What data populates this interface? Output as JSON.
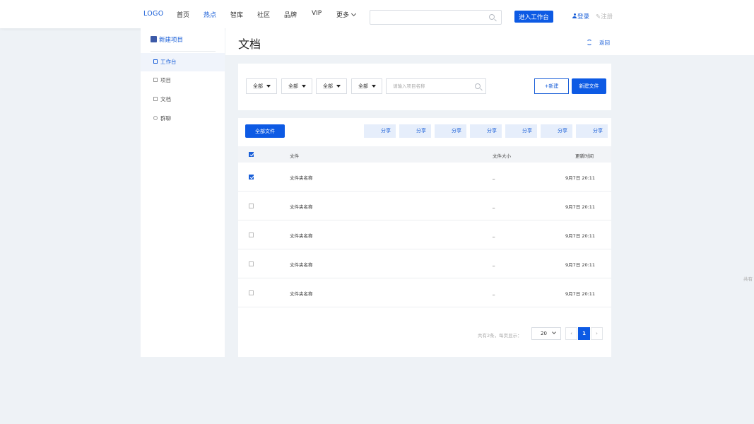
{
  "header": {
    "logo": "LOGO",
    "nav": [
      "首页",
      "热点",
      "智库",
      "社区",
      "品牌",
      "VIP",
      "更多"
    ],
    "active_nav": "热点",
    "enter_button": "进入工作台",
    "login": "登录",
    "register": "注册"
  },
  "sidebar": {
    "title": "新建项目",
    "items": [
      {
        "label": "工作台",
        "icon": "monitor-icon"
      },
      {
        "label": "项目",
        "icon": "list-icon"
      },
      {
        "label": "文档",
        "icon": "document-icon"
      },
      {
        "label": "群聊",
        "icon": "chat-icon"
      }
    ],
    "active_item": "工作台"
  },
  "page": {
    "title": "文档",
    "back": "返回"
  },
  "filters": {
    "dropdowns": [
      "全部",
      "全部",
      "全部",
      "全部"
    ],
    "search_placeholder": "请输入项目名称",
    "new_button": "+新建",
    "new_file_button": "新建文件"
  },
  "table": {
    "all_files_button": "全部文件",
    "share_buttons": [
      "分享",
      "分享",
      "分享",
      "分享",
      "分享",
      "分享",
      "分享"
    ],
    "columns": [
      "文件",
      "文件大小",
      "更新时间"
    ],
    "header_checked": true,
    "rows": [
      {
        "checked": true,
        "name": "文件夹名称",
        "size": "_",
        "updated": "9月7日 20:11"
      },
      {
        "checked": false,
        "name": "文件夹名称",
        "size": "_",
        "updated": "9月7日 20:11"
      },
      {
        "checked": false,
        "name": "文件夹名称",
        "size": "_",
        "updated": "9月7日 20:11"
      },
      {
        "checked": false,
        "name": "文件夹名称",
        "size": "_",
        "updated": "9月7日 20:11"
      },
      {
        "checked": false,
        "name": "文件夹名称",
        "size": "_",
        "updated": "9月7日 20:11"
      }
    ]
  },
  "pagination": {
    "summary": "共有2条，每页显示：",
    "per_page": "20",
    "prev": "‹",
    "current": "1",
    "next": "›"
  },
  "edge_text": "共有",
  "colors": {
    "primary": "#0d5ae4",
    "link": "#1a5fd8",
    "background": "#eef2f6",
    "share_bg": "#e6eefb"
  }
}
